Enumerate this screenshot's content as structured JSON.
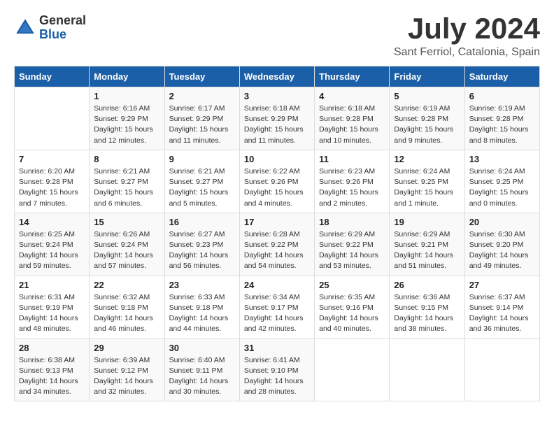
{
  "header": {
    "logo_general": "General",
    "logo_blue": "Blue",
    "month_year": "July 2024",
    "location": "Sant Ferriol, Catalonia, Spain"
  },
  "days_of_week": [
    "Sunday",
    "Monday",
    "Tuesday",
    "Wednesday",
    "Thursday",
    "Friday",
    "Saturday"
  ],
  "weeks": [
    [
      {
        "day": "",
        "info": ""
      },
      {
        "day": "1",
        "info": "Sunrise: 6:16 AM\nSunset: 9:29 PM\nDaylight: 15 hours\nand 12 minutes."
      },
      {
        "day": "2",
        "info": "Sunrise: 6:17 AM\nSunset: 9:29 PM\nDaylight: 15 hours\nand 11 minutes."
      },
      {
        "day": "3",
        "info": "Sunrise: 6:18 AM\nSunset: 9:29 PM\nDaylight: 15 hours\nand 11 minutes."
      },
      {
        "day": "4",
        "info": "Sunrise: 6:18 AM\nSunset: 9:28 PM\nDaylight: 15 hours\nand 10 minutes."
      },
      {
        "day": "5",
        "info": "Sunrise: 6:19 AM\nSunset: 9:28 PM\nDaylight: 15 hours\nand 9 minutes."
      },
      {
        "day": "6",
        "info": "Sunrise: 6:19 AM\nSunset: 9:28 PM\nDaylight: 15 hours\nand 8 minutes."
      }
    ],
    [
      {
        "day": "7",
        "info": "Sunrise: 6:20 AM\nSunset: 9:28 PM\nDaylight: 15 hours\nand 7 minutes."
      },
      {
        "day": "8",
        "info": "Sunrise: 6:21 AM\nSunset: 9:27 PM\nDaylight: 15 hours\nand 6 minutes."
      },
      {
        "day": "9",
        "info": "Sunrise: 6:21 AM\nSunset: 9:27 PM\nDaylight: 15 hours\nand 5 minutes."
      },
      {
        "day": "10",
        "info": "Sunrise: 6:22 AM\nSunset: 9:26 PM\nDaylight: 15 hours\nand 4 minutes."
      },
      {
        "day": "11",
        "info": "Sunrise: 6:23 AM\nSunset: 9:26 PM\nDaylight: 15 hours\nand 2 minutes."
      },
      {
        "day": "12",
        "info": "Sunrise: 6:24 AM\nSunset: 9:25 PM\nDaylight: 15 hours\nand 1 minute."
      },
      {
        "day": "13",
        "info": "Sunrise: 6:24 AM\nSunset: 9:25 PM\nDaylight: 15 hours\nand 0 minutes."
      }
    ],
    [
      {
        "day": "14",
        "info": "Sunrise: 6:25 AM\nSunset: 9:24 PM\nDaylight: 14 hours\nand 59 minutes."
      },
      {
        "day": "15",
        "info": "Sunrise: 6:26 AM\nSunset: 9:24 PM\nDaylight: 14 hours\nand 57 minutes."
      },
      {
        "day": "16",
        "info": "Sunrise: 6:27 AM\nSunset: 9:23 PM\nDaylight: 14 hours\nand 56 minutes."
      },
      {
        "day": "17",
        "info": "Sunrise: 6:28 AM\nSunset: 9:22 PM\nDaylight: 14 hours\nand 54 minutes."
      },
      {
        "day": "18",
        "info": "Sunrise: 6:29 AM\nSunset: 9:22 PM\nDaylight: 14 hours\nand 53 minutes."
      },
      {
        "day": "19",
        "info": "Sunrise: 6:29 AM\nSunset: 9:21 PM\nDaylight: 14 hours\nand 51 minutes."
      },
      {
        "day": "20",
        "info": "Sunrise: 6:30 AM\nSunset: 9:20 PM\nDaylight: 14 hours\nand 49 minutes."
      }
    ],
    [
      {
        "day": "21",
        "info": "Sunrise: 6:31 AM\nSunset: 9:19 PM\nDaylight: 14 hours\nand 48 minutes."
      },
      {
        "day": "22",
        "info": "Sunrise: 6:32 AM\nSunset: 9:18 PM\nDaylight: 14 hours\nand 46 minutes."
      },
      {
        "day": "23",
        "info": "Sunrise: 6:33 AM\nSunset: 9:18 PM\nDaylight: 14 hours\nand 44 minutes."
      },
      {
        "day": "24",
        "info": "Sunrise: 6:34 AM\nSunset: 9:17 PM\nDaylight: 14 hours\nand 42 minutes."
      },
      {
        "day": "25",
        "info": "Sunrise: 6:35 AM\nSunset: 9:16 PM\nDaylight: 14 hours\nand 40 minutes."
      },
      {
        "day": "26",
        "info": "Sunrise: 6:36 AM\nSunset: 9:15 PM\nDaylight: 14 hours\nand 38 minutes."
      },
      {
        "day": "27",
        "info": "Sunrise: 6:37 AM\nSunset: 9:14 PM\nDaylight: 14 hours\nand 36 minutes."
      }
    ],
    [
      {
        "day": "28",
        "info": "Sunrise: 6:38 AM\nSunset: 9:13 PM\nDaylight: 14 hours\nand 34 minutes."
      },
      {
        "day": "29",
        "info": "Sunrise: 6:39 AM\nSunset: 9:12 PM\nDaylight: 14 hours\nand 32 minutes."
      },
      {
        "day": "30",
        "info": "Sunrise: 6:40 AM\nSunset: 9:11 PM\nDaylight: 14 hours\nand 30 minutes."
      },
      {
        "day": "31",
        "info": "Sunrise: 6:41 AM\nSunset: 9:10 PM\nDaylight: 14 hours\nand 28 minutes."
      },
      {
        "day": "",
        "info": ""
      },
      {
        "day": "",
        "info": ""
      },
      {
        "day": "",
        "info": ""
      }
    ]
  ]
}
